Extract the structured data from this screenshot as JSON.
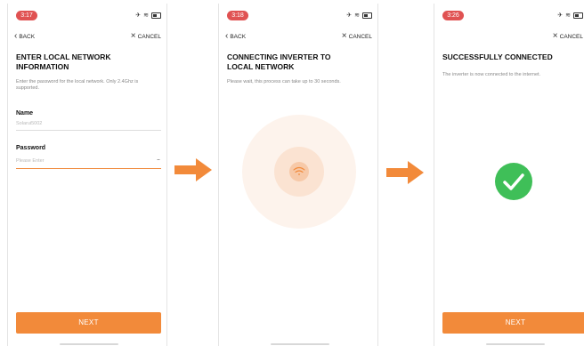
{
  "colors": {
    "accent": "#f28a3a",
    "success": "#3fbf58",
    "time_badge": "#e05252",
    "placeholder": "#b8b8b8"
  },
  "screen1": {
    "time": "3:17",
    "back_label": "BACK",
    "cancel_label": "CANCEL",
    "title_line1": "ENTER LOCAL NETWORK",
    "title_line2": "INFORMATION",
    "description": "Enter the password for the local network. Only 2.4Ghz is supported.",
    "name_label": "Name",
    "name_value": "Solarui5002",
    "password_label": "Password",
    "password_placeholder": "Please Enter",
    "next_label": "NEXT"
  },
  "screen2": {
    "time": "3:18",
    "back_label": "BACK",
    "cancel_label": "CANCEL",
    "title_line1": "CONNECTING INVERTER TO",
    "title_line2": "LOCAL NETWORK",
    "description": "Please wait, this process can take up to 30 seconds."
  },
  "screen3": {
    "time": "3:26",
    "cancel_label": "CANCEL",
    "title": "SUCCESSFULLY CONNECTED",
    "description": "The inverter is now connected to the internet.",
    "next_label": "NEXT"
  },
  "icons": {
    "status": [
      "airplane-icon",
      "wifi-icon",
      "battery-icon"
    ],
    "back": "chevron-left-icon",
    "cancel": "close-icon",
    "password_toggle": "eye-closed-icon",
    "connecting": "wifi-signal-icon",
    "success": "checkmark-icon",
    "flow": "arrow-right-icon"
  }
}
